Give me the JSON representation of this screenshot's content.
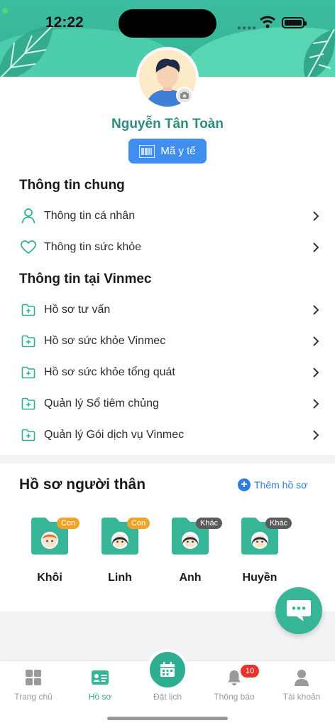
{
  "status_bar": {
    "time": "12:22"
  },
  "profile": {
    "name": "Nguyễn Tân Toàn",
    "medical_code_label": "Mã y tế"
  },
  "general_info": {
    "title": "Thông tin chung",
    "items": [
      {
        "label": "Thông tin cá nhân",
        "icon": "user-icon"
      },
      {
        "label": "Thông tin sức khỏe",
        "icon": "heart-icon"
      }
    ]
  },
  "vinmec_info": {
    "title": "Thông tin tại Vinmec",
    "items": [
      {
        "label": "Hồ sơ tư vấn",
        "icon": "folder-plus-icon"
      },
      {
        "label": "Hồ sơ sức khỏe Vinmec",
        "icon": "folder-plus-icon"
      },
      {
        "label": "Hồ sơ sức khỏe tổng quát",
        "icon": "folder-plus-icon"
      },
      {
        "label": "Quản lý Sổ tiêm chủng",
        "icon": "folder-plus-icon"
      },
      {
        "label": "Quản lý Gói dịch vụ Vinmec",
        "icon": "folder-plus-icon"
      }
    ]
  },
  "relatives": {
    "title": "Hồ sơ người thân",
    "add_label": "Thêm hồ sơ",
    "items": [
      {
        "name": "Khôi",
        "tag": "Con"
      },
      {
        "name": "Linh",
        "tag": "Con"
      },
      {
        "name": "Anh",
        "tag": "Khác"
      },
      {
        "name": "Huyền",
        "tag": "Khác"
      }
    ]
  },
  "bottom_nav": {
    "items": [
      {
        "label": "Trang chủ",
        "icon": "grid-icon"
      },
      {
        "label": "Hồ sơ",
        "icon": "profile-card-icon",
        "active": true
      },
      {
        "label": "Đặt lịch",
        "icon": "calendar-icon"
      },
      {
        "label": "Thông báo",
        "icon": "bell-icon",
        "badge": "10"
      },
      {
        "label": "Tài khoản",
        "icon": "account-icon"
      }
    ]
  },
  "colors": {
    "brand": "#36b597",
    "name_text": "#2e8b7b",
    "button_blue": "#3f8ef0",
    "link_blue": "#2d7de0",
    "tag_con": "#f0a326",
    "tag_khac": "#5b5b5b",
    "badge_red": "#e8332b"
  }
}
